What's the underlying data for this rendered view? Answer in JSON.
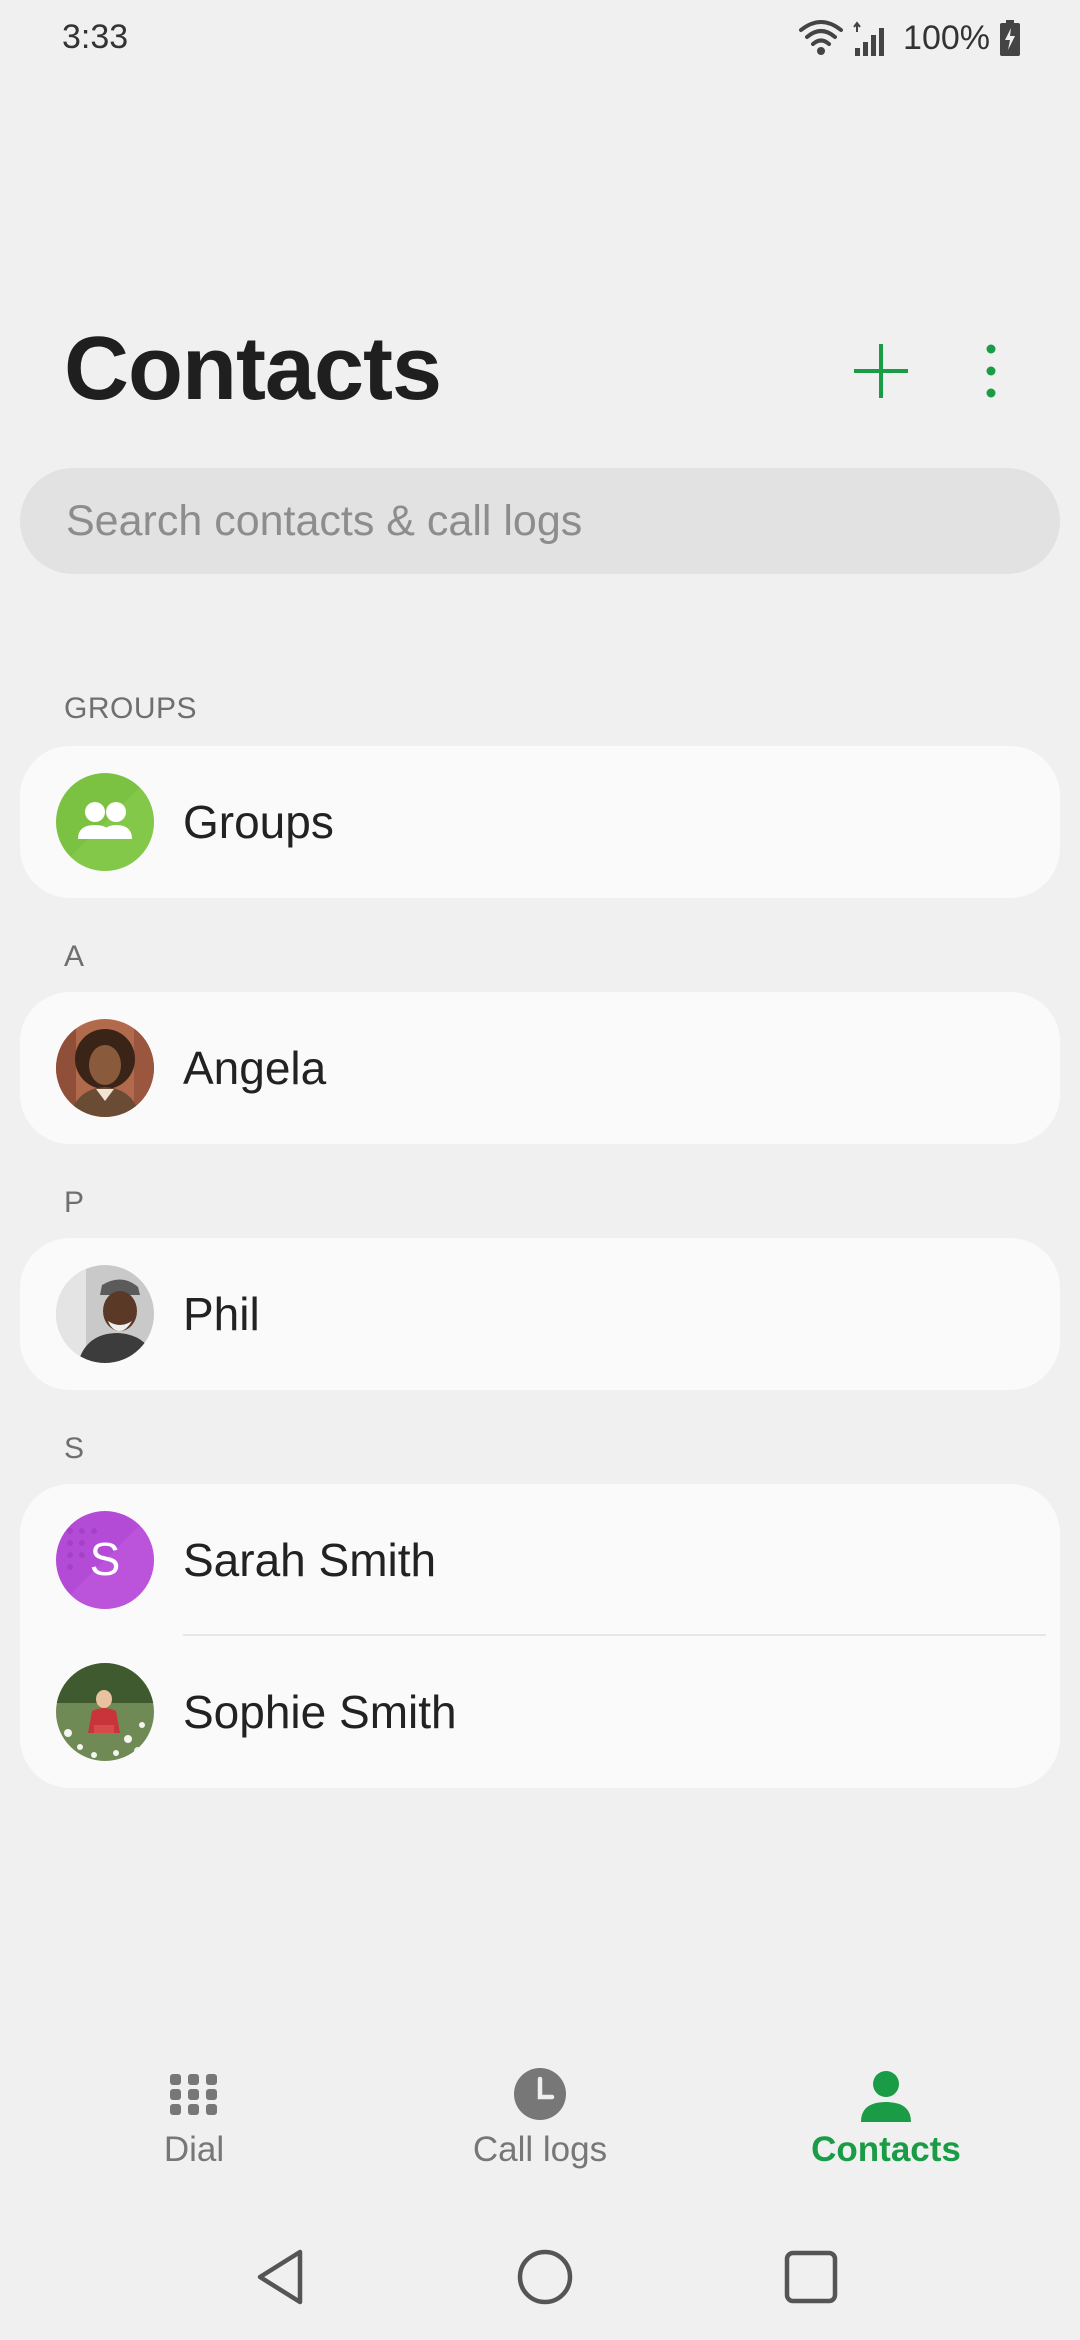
{
  "status_bar": {
    "time": "3:33",
    "battery": "100%"
  },
  "header": {
    "title": "Contacts",
    "add_icon": "plus-icon",
    "more_icon": "more-vert-icon",
    "accent_color": "#1a9b45"
  },
  "search": {
    "placeholder": "Search contacts & call logs"
  },
  "sections": [
    {
      "header": "GROUPS",
      "items": [
        {
          "name": "Groups",
          "avatar": "groups-icon",
          "avatar_color": "#7cc242"
        }
      ]
    },
    {
      "header": "A",
      "items": [
        {
          "name": "Angela",
          "avatar": "photo"
        }
      ]
    },
    {
      "header": "P",
      "items": [
        {
          "name": "Phil",
          "avatar": "photo"
        }
      ]
    },
    {
      "header": "S",
      "items": [
        {
          "name": "Sarah Smith",
          "avatar": "letter",
          "avatar_letter": "S",
          "avatar_color": "#b44bd6"
        },
        {
          "name": "Sophie Smith",
          "avatar": "photo"
        }
      ]
    }
  ],
  "bottom_nav": {
    "items": [
      {
        "label": "Dial",
        "icon": "dialpad-icon",
        "active": false
      },
      {
        "label": "Call logs",
        "icon": "clock-icon",
        "active": false
      },
      {
        "label": "Contacts",
        "icon": "person-icon",
        "active": true
      }
    ],
    "active_color": "#1a9b45",
    "inactive_color": "#777777"
  },
  "system_nav": {
    "items": [
      "back-icon",
      "home-icon",
      "recents-icon"
    ]
  }
}
